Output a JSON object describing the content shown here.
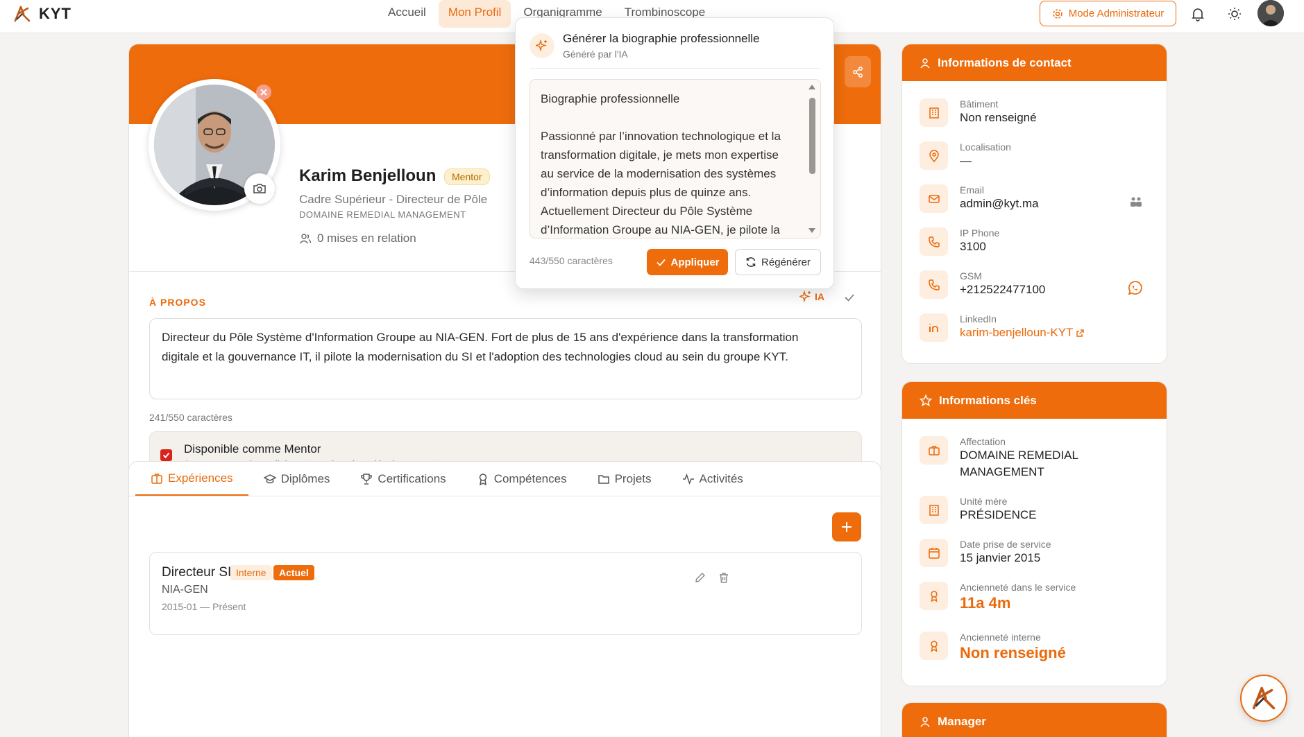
{
  "app": {
    "logo_text": "KYT"
  },
  "nav": [
    {
      "label": "Accueil"
    },
    {
      "label": "Mon Profil"
    },
    {
      "label": "Organigramme"
    },
    {
      "label": "Trombinoscope"
    }
  ],
  "header": {
    "admin_label": "Mode Administrateur"
  },
  "profile": {
    "name": "Karim Benjelloun",
    "badge": "Mentor",
    "role": "Cadre Supérieur - Directeur de Pôle",
    "domain": "DOMAINE REMEDIAL MANAGEMENT",
    "relations": "0 mises en relation"
  },
  "about": {
    "title": "À PROPOS",
    "ia_label": "IA",
    "bio_line1": "Directeur du Pôle Système d'Information Groupe au NIA-GEN. Fort de plus de 15 ans d'expérience dans la transformation",
    "bio_line2": "digitale et la gouvernance IT, il pilote la modernisation du SI et l'adoption des technologies cloud au sein du groupe KYT.",
    "char_count": "241/550 caractères",
    "mentor_label": "Disponible comme Mentor",
    "mentor_sub": "Accompagner des collaborateurs dans leur développement"
  },
  "tabs": [
    {
      "label": "Expériences"
    },
    {
      "label": "Diplômes"
    },
    {
      "label": "Certifications"
    },
    {
      "label": "Compétences"
    },
    {
      "label": "Projets"
    },
    {
      "label": "Activités"
    }
  ],
  "experience": {
    "title": "Directeur SI",
    "tag_type": "Interne",
    "tag_status": "Actuel",
    "company": "NIA-GEN",
    "dates": "2015-01 — Présent"
  },
  "contact": {
    "title": "Informations de contact",
    "rows": [
      {
        "label": "Bâtiment",
        "value": "Non renseigné"
      },
      {
        "label": "Localisation",
        "value": "—"
      },
      {
        "label": "Email",
        "value": "admin@kyt.ma"
      },
      {
        "label": "IP Phone",
        "value": "3100"
      },
      {
        "label": "GSM",
        "value": "+212522477100"
      },
      {
        "label": "LinkedIn",
        "value": "karim-benjelloun-KYT"
      }
    ]
  },
  "key_info": {
    "title": "Informations clés",
    "rows": [
      {
        "label": "Affectation",
        "value_line1": "DOMAINE REMEDIAL",
        "value_line2": "MANAGEMENT"
      },
      {
        "label": "Unité mère",
        "value": "PRÉSIDENCE"
      },
      {
        "label": "Date prise de service",
        "value": "15 janvier 2015"
      },
      {
        "label": "Ancienneté dans le service",
        "value": "11a 4m"
      },
      {
        "label": "Ancienneté interne",
        "value": "Non renseigné"
      }
    ]
  },
  "manager": {
    "title": "Manager"
  },
  "popup": {
    "title": "Générer la biographie professionnelle",
    "subtitle": "Généré par l'IA",
    "heading": "Biographie professionnelle",
    "lines": [
      "Passionné par l’innovation technologique et la",
      "transformation digitale, je mets mon expertise",
      "au service de la modernisation des systèmes",
      "d’information depuis plus de quinze ans.",
      "Actuellement Directeur du Pôle Système",
      "d’Information Groupe au NIA-GEN, je pilote la"
    ],
    "char_count": "443/550 caractères",
    "apply_label": "Appliquer",
    "regen_label": "Régénérer"
  },
  "colors": {
    "accent": "#ef6c0c",
    "accent_light": "#fdeee0",
    "check": "#d9241c"
  }
}
